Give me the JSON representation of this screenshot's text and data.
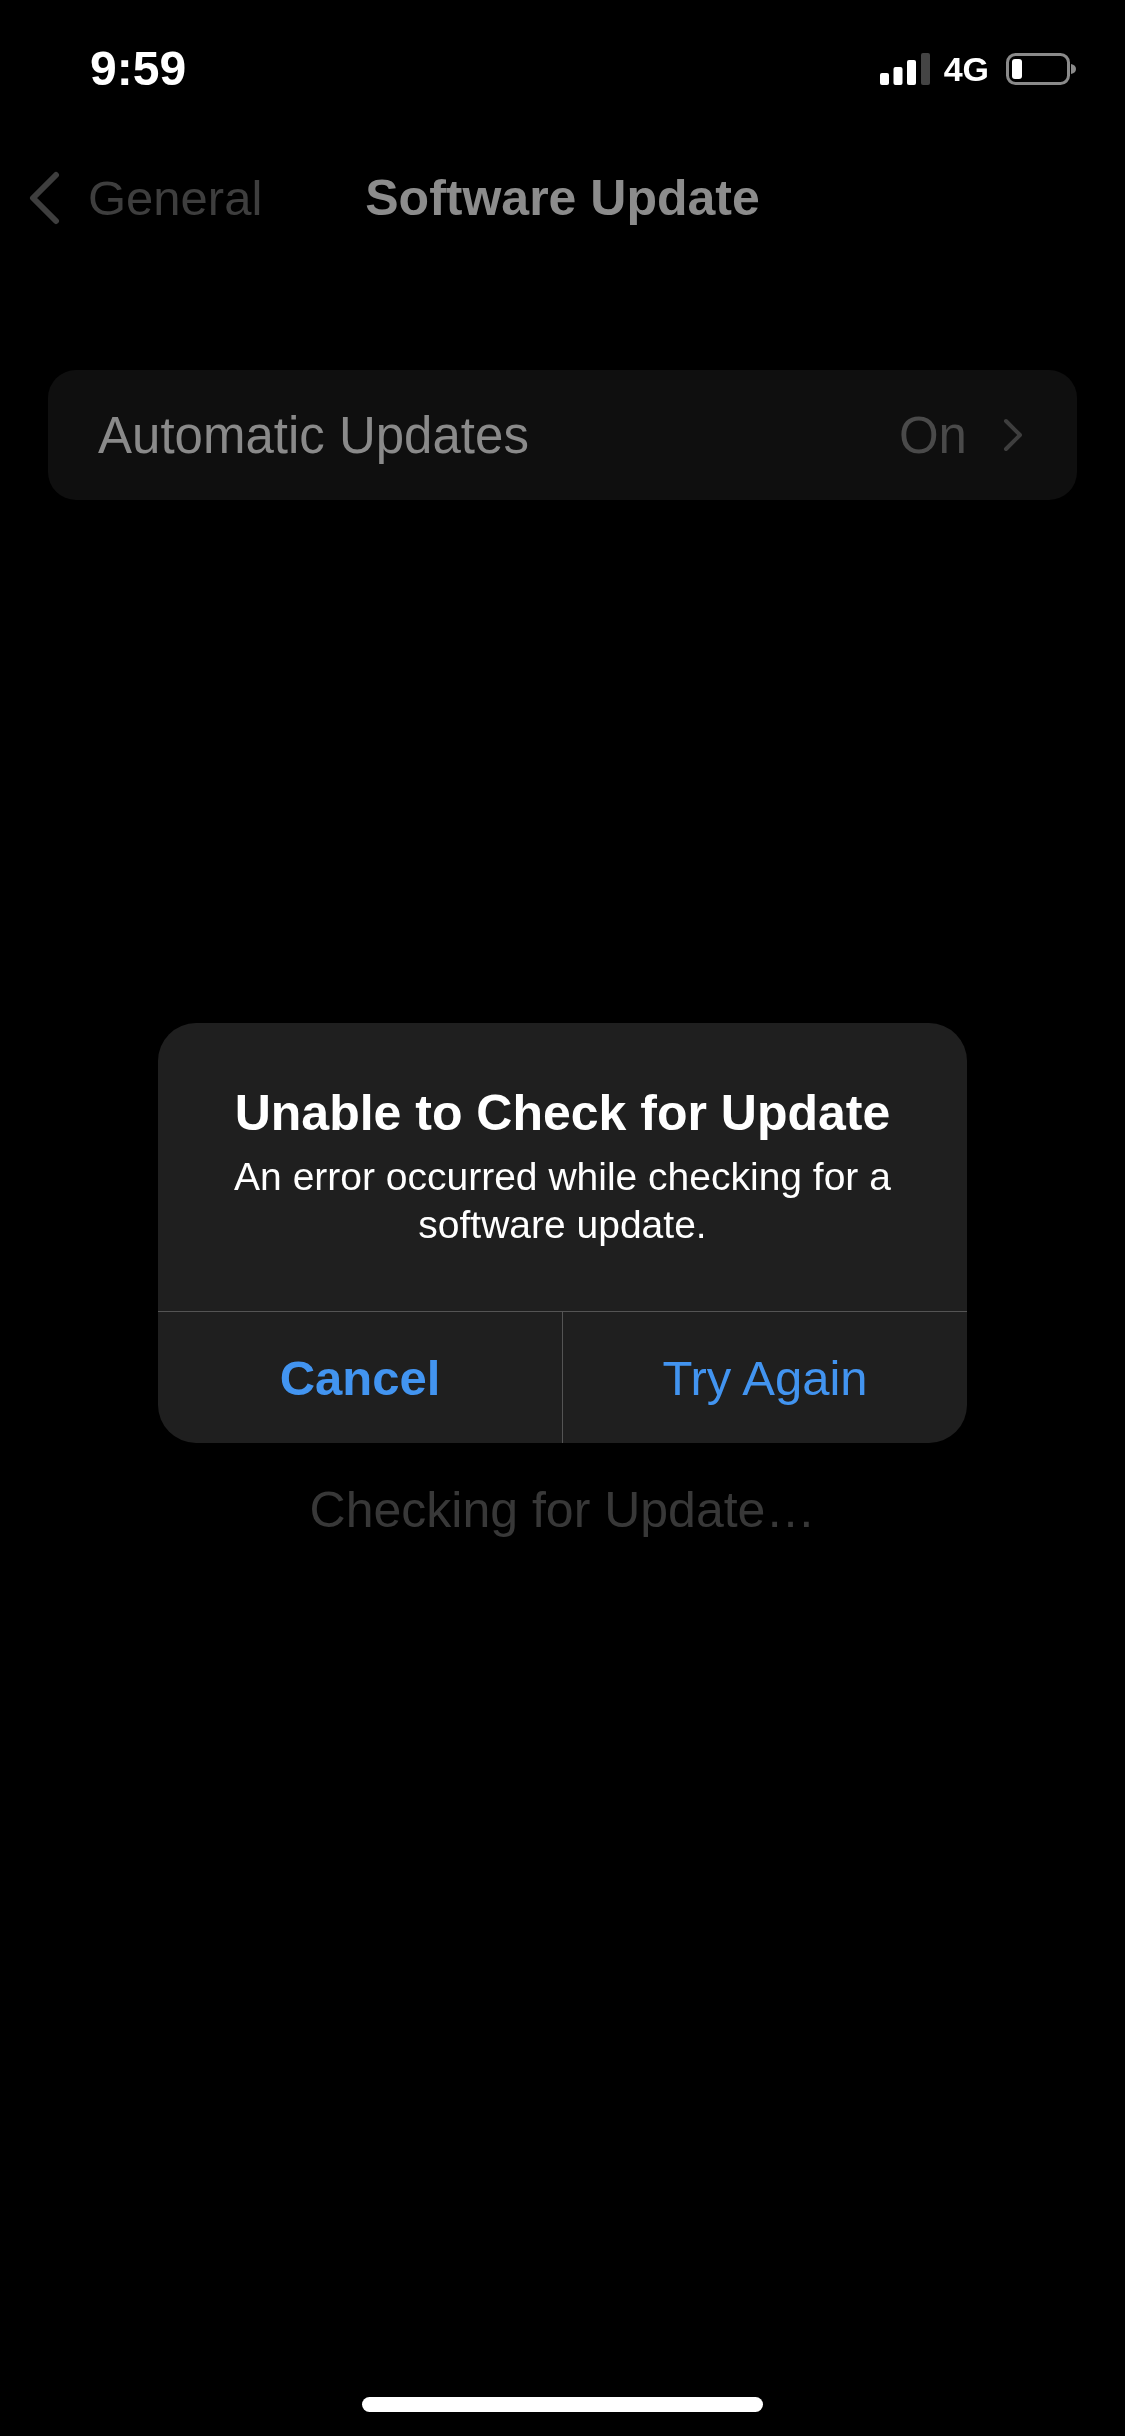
{
  "status_bar": {
    "time": "9:59",
    "network": "4G"
  },
  "nav_bar": {
    "back_label": "General",
    "title": "Software Update"
  },
  "settings": [
    {
      "label": "Automatic Updates",
      "value": "On"
    }
  ],
  "status_text": "Checking for Update…",
  "alert": {
    "title": "Unable to Check for Update",
    "message": "An error occurred while checking for a software update.",
    "buttons": [
      {
        "label": "Cancel",
        "kind": "cancel"
      },
      {
        "label": "Try Again",
        "kind": "default"
      }
    ]
  }
}
